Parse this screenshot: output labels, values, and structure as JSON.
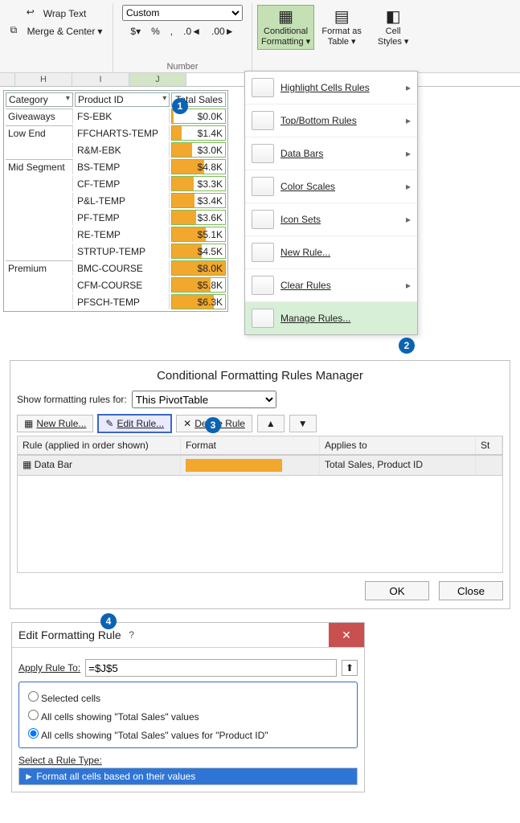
{
  "ribbon": {
    "wrap": "Wrap Text",
    "merge": "Merge & Center",
    "number_format": "Custom",
    "percent": "%",
    "comma": ",",
    "inc": ".00→.0",
    "dec": ".0→.00",
    "number_label": "Number",
    "cond": "Conditional\nFormatting ▾",
    "fat": "Format as\nTable ▾",
    "styles": "Cell\nStyles ▾"
  },
  "columns": [
    "H",
    "I",
    "J"
  ],
  "table": {
    "headers": [
      "Category",
      "Product ID",
      "Total Sales"
    ],
    "blocks": [
      {
        "cat": "Giveaways",
        "rows": [
          {
            "p": "FS-EBK",
            "v": "$0.0K",
            "w": 2
          }
        ]
      },
      {
        "cat": "Low End",
        "rows": [
          {
            "p": "FFCHARTS-TEMP",
            "v": "$1.4K",
            "w": 18
          },
          {
            "p": "R&M-EBK",
            "v": "$3.0K",
            "w": 38
          }
        ]
      },
      {
        "cat": "Mid Segment",
        "rows": [
          {
            "p": "BS-TEMP",
            "v": "$4.8K",
            "w": 60
          },
          {
            "p": "CF-TEMP",
            "v": "$3.3K",
            "w": 41
          },
          {
            "p": "P&L-TEMP",
            "v": "$3.4K",
            "w": 42
          },
          {
            "p": "PF-TEMP",
            "v": "$3.6K",
            "w": 45
          },
          {
            "p": "RE-TEMP",
            "v": "$5.1K",
            "w": 64
          },
          {
            "p": "STRTUP-TEMP",
            "v": "$4.5K",
            "w": 56
          }
        ]
      },
      {
        "cat": "Premium",
        "rows": [
          {
            "p": "BMC-COURSE",
            "v": "$8.0K",
            "w": 100
          },
          {
            "p": "CFM-COURSE",
            "v": "$5.8K",
            "w": 72
          },
          {
            "p": "PFSCH-TEMP",
            "v": "$6.3K",
            "w": 79
          }
        ]
      }
    ]
  },
  "menu": {
    "items": [
      "Highlight Cells Rules",
      "Top/Bottom Rules",
      "Data Bars",
      "Color Scales",
      "Icon Sets"
    ],
    "new": "New Rule...",
    "clear": "Clear Rules",
    "manage": "Manage Rules..."
  },
  "dlg1": {
    "title": "Conditional Formatting Rules Manager",
    "show_label": "Show formatting rules for:",
    "show_value": "This PivotTable",
    "new": "New Rule...",
    "edit": "Edit Rule...",
    "del": "Delete Rule",
    "hdr": [
      "Rule (applied in order shown)",
      "Format",
      "Applies to",
      "St"
    ],
    "rule_name": "Data Bar",
    "applies": "Total Sales, Product ID",
    "ok": "OK",
    "close": "Close"
  },
  "dlg2": {
    "title": "Edit Formatting Rule",
    "apply_label": "Apply Rule To:",
    "apply_value": "=$J$5",
    "opt1": "Selected cells",
    "opt2": "All cells showing \"Total Sales\" values",
    "opt3": "All cells showing \"Total Sales\" values for \"Product ID\"",
    "selrt": "Select a Rule Type:",
    "rt1": "► Format all cells based on their values"
  }
}
